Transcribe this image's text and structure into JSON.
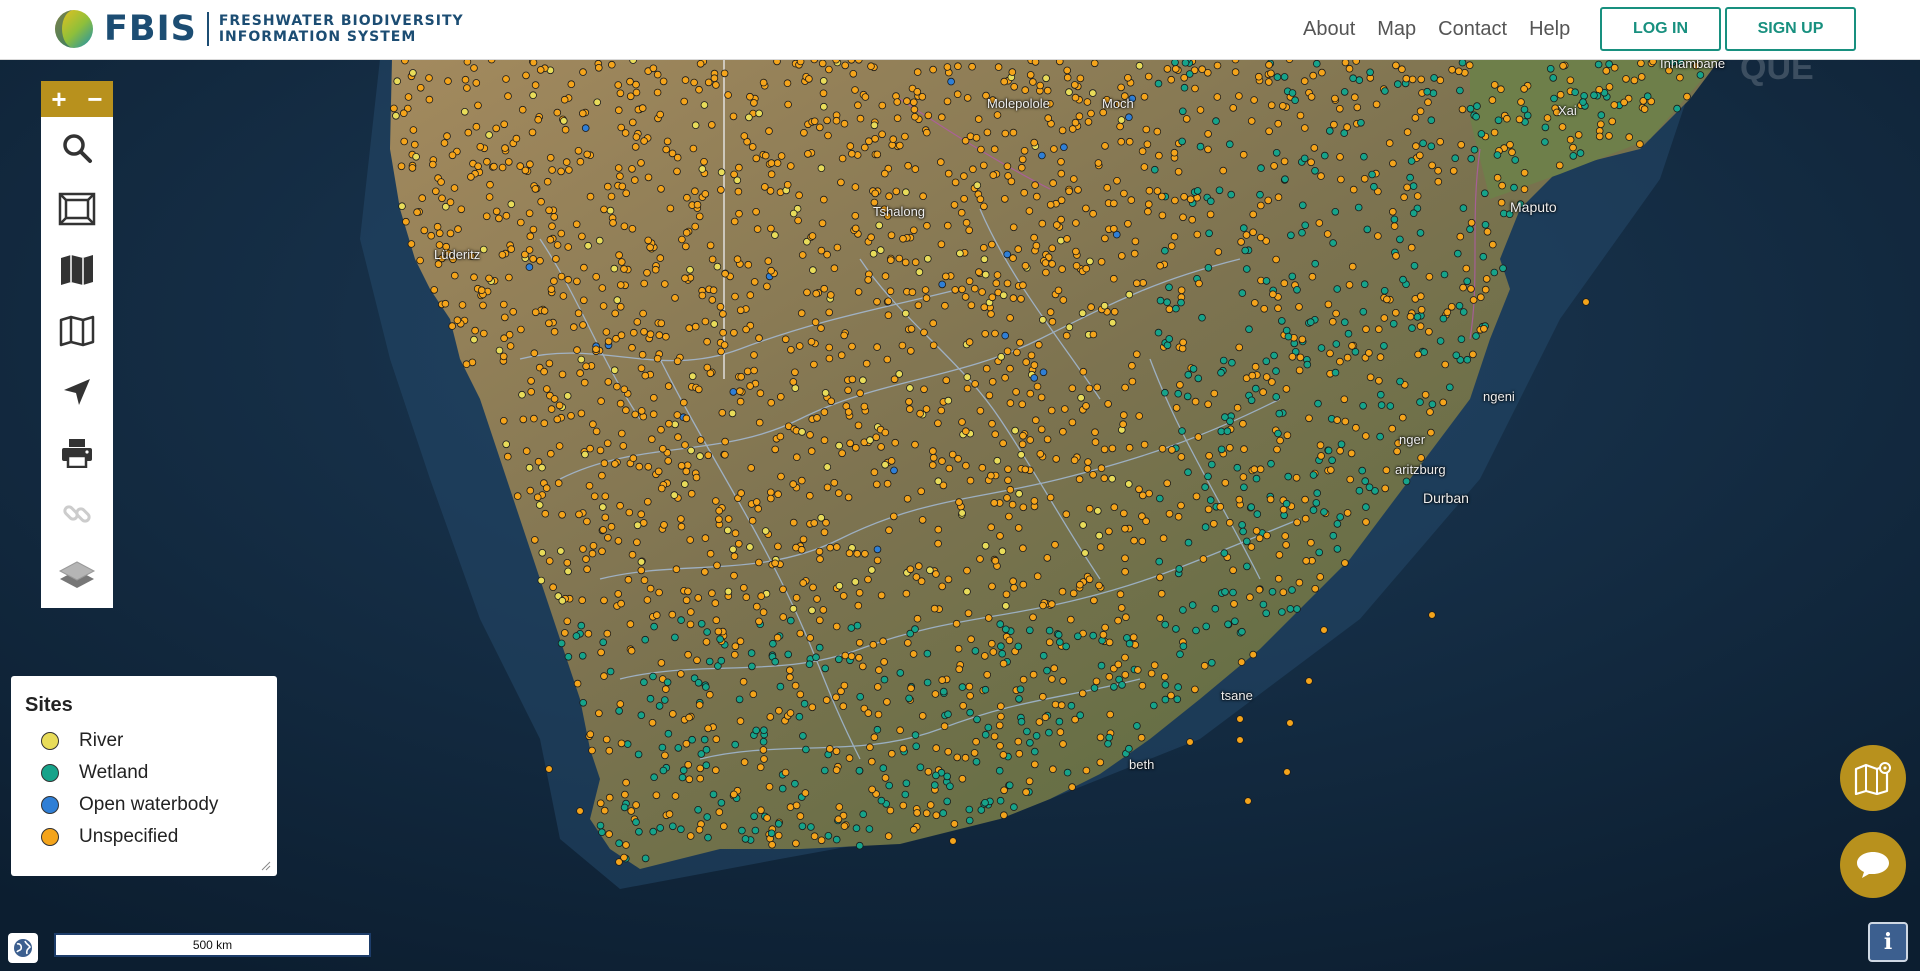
{
  "header": {
    "brand": "FBIS",
    "brand_sub_line1": "FRESHWATER BIODIVERSITY",
    "brand_sub_line2": "INFORMATION SYSTEM",
    "nav": [
      "About",
      "Map",
      "Contact",
      "Help"
    ],
    "login_label": "LOG IN",
    "signup_label": "SIGN UP",
    "accent_color": "#18907f"
  },
  "toolbar": {
    "zoom_in": "+",
    "zoom_out": "−",
    "tools": [
      "search-icon",
      "zoom-extent-icon",
      "map-filled-icon",
      "map-outline-icon",
      "locate-arrow-icon",
      "print-icon",
      "link-icon",
      "layers-icon"
    ],
    "accent_color": "#b8911d"
  },
  "map_labels": [
    "Inhambane",
    "Molepolole",
    "Moch",
    "Xai",
    "Maputo",
    "Tshalong",
    "Lüderitz",
    "ngeni",
    "nger",
    "aritzburg",
    "Durban",
    "tsane",
    "beth",
    "QUE"
  ],
  "legend": {
    "title": "Sites",
    "items": [
      {
        "label": "River",
        "color": "#e8dc5a"
      },
      {
        "label": "Wetland",
        "color": "#16a38a"
      },
      {
        "label": "Open waterbody",
        "color": "#2f7fd6"
      },
      {
        "label": "Unspecified",
        "color": "#f4a41b"
      }
    ]
  },
  "scale_label": "500 km",
  "info_label": "i",
  "fabs": [
    "map-pin-icon",
    "chat-icon"
  ]
}
